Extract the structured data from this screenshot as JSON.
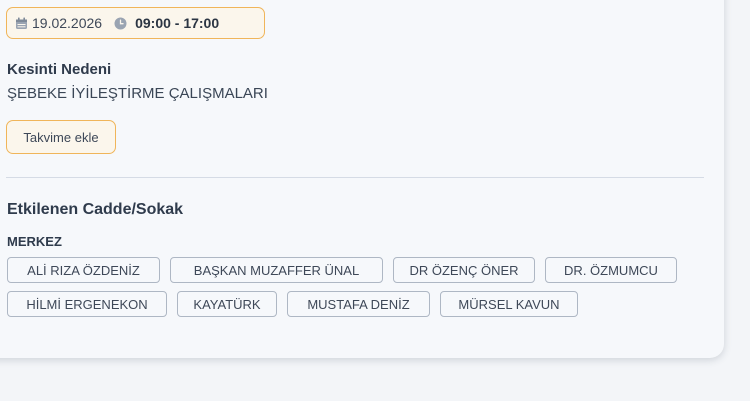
{
  "outage": {
    "date": "19.02.2026",
    "time_range": "09:00 - 17:00",
    "reason_label": "Kesinti Nedeni",
    "reason_value": "ŞEBEKE İYİLEŞTİRME ÇALIŞMALARI",
    "calendar_button": "Takvime ekle"
  },
  "affected": {
    "label": "Etkilenen Cadde/Sokak",
    "district": "MERKEZ",
    "streets_row1": [
      "ALİ RIZA ÖZDENİZ",
      "BAŞKAN MUZAFFER ÜNAL",
      "DR ÖZENÇ ÖNER",
      "DR. ÖZMUMCU"
    ],
    "streets_row2": [
      "HİLMİ ERGENEKON",
      "KAYATÜRK",
      "MUSTAFA DENİZ",
      "MÜRSEL KAVUN"
    ]
  },
  "icons": {
    "date": "calendar-icon",
    "time": "clock-icon"
  },
  "colors": {
    "accent_border": "#f0b55a",
    "tag_border": "#aeb7c4",
    "text": "#2f3b4c"
  }
}
